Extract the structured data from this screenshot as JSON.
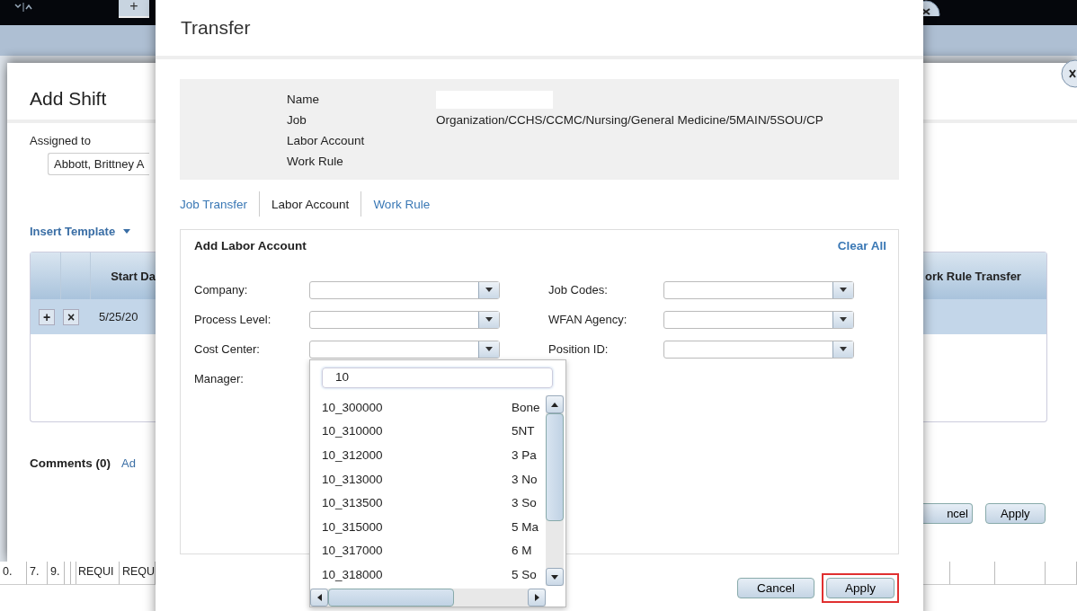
{
  "background": {
    "top_tab": "+",
    "window": {
      "title": "Add Shift",
      "assigned_to_label": "Assigned to",
      "assigned_to_value": "Abbott, Brittney A",
      "insert_template": "Insert Template",
      "table": {
        "column_3": "Start Da",
        "last_column": "ork Rule Transfer",
        "row": {
          "selected": true,
          "add": "+",
          "remove": "×",
          "date": "5/25/20"
        }
      },
      "comments": "Comments (0)",
      "comments_link": "Ad",
      "buttons": [
        "ncel",
        "Apply"
      ]
    },
    "grid_row": [
      "0.",
      "7.",
      "9.",
      "REQUI",
      "REQU"
    ]
  },
  "transfer_dialog": {
    "title": "Transfer",
    "summary": [
      {
        "label": "Name",
        "redacted": true
      },
      {
        "label": "Job",
        "value": "Organization/CCHS/CCMC/Nursing/General Medicine/5MAIN/5SOU/CP"
      },
      {
        "label": "Labor Account"
      },
      {
        "label": "Work Rule"
      }
    ],
    "tabs": [
      {
        "label": "Job Transfer",
        "selected": false
      },
      {
        "label": "Labor Account",
        "selected": true
      },
      {
        "label": "Work Rule",
        "selected": false
      }
    ],
    "panel": {
      "title": "Add Labor Account",
      "clear_all": "Clear All",
      "left_fields": [
        {
          "label": "Company:",
          "kind": "select"
        },
        {
          "label": "Process Level:",
          "kind": "select"
        },
        {
          "label": "Cost Center:",
          "kind": "select"
        },
        {
          "label": "Manager:",
          "kind": "label"
        }
      ],
      "right_fields": [
        {
          "label": "Job Codes:",
          "kind": "select"
        },
        {
          "label": "WFAN Agency:",
          "kind": "select"
        },
        {
          "label": "Position ID:",
          "kind": "select"
        }
      ]
    },
    "dropdown": {
      "search_value": "10",
      "items": [
        {
          "code": "10_300000",
          "name": "Bone"
        },
        {
          "code": "10_310000",
          "name": "5NT"
        },
        {
          "code": "10_312000",
          "name": "3 Pa"
        },
        {
          "code": "10_313000",
          "name": "3 No"
        },
        {
          "code": "10_313500",
          "name": "3 So"
        },
        {
          "code": "10_315000",
          "name": "5 Ma"
        },
        {
          "code": "10_317000",
          "name": "6 M"
        },
        {
          "code": "10_318000",
          "name": "5 So"
        }
      ]
    },
    "buttons": [
      {
        "label": "Cancel",
        "highlighted": false
      },
      {
        "label": "Apply",
        "highlighted": true
      }
    ]
  }
}
